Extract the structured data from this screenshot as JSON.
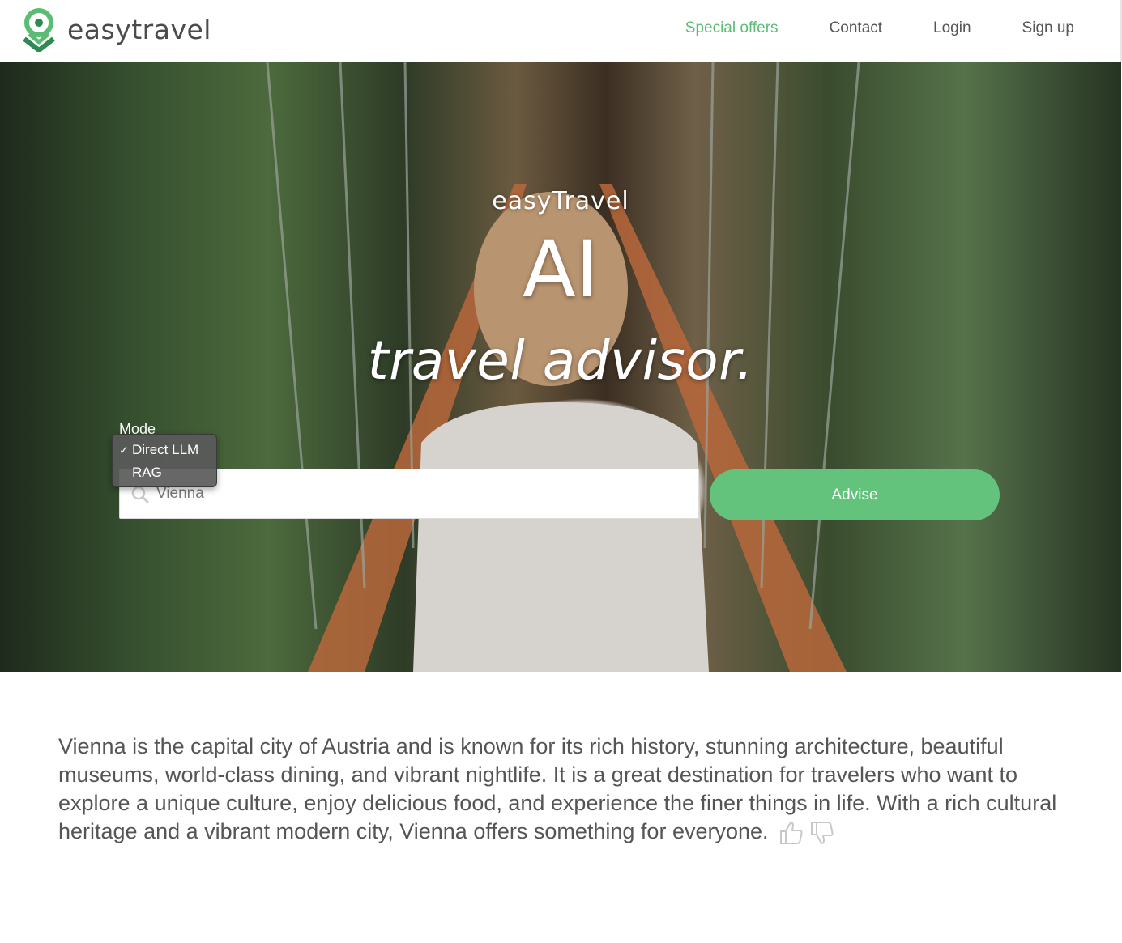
{
  "header": {
    "brand": "easytravel",
    "nav": [
      {
        "label": "Special offers",
        "active": true
      },
      {
        "label": "Contact",
        "active": false
      },
      {
        "label": "Login",
        "active": false
      },
      {
        "label": "Sign up",
        "active": false
      }
    ]
  },
  "hero": {
    "title_small": "easyTravel",
    "title_large": "AI",
    "title_sub": "travel advisor."
  },
  "form": {
    "mode_label": "Mode",
    "mode_options": [
      "Direct LLM",
      "RAG"
    ],
    "selected_mode": "Direct LLM",
    "search_value": "Vienna",
    "advise_label": "Advise"
  },
  "answer": {
    "text": "Vienna is the capital city of Austria and is known for its rich history, stunning architecture, beautiful museums, world-class dining, and vibrant nightlife. It is a great destination for travelers who want to explore a unique culture, enjoy delicious food, and experience the finer things in life. With a rich cultural heritage and a vibrant modern city, Vienna offers something for everyone."
  },
  "colors": {
    "accent": "#5bbd74",
    "button": "#63c27b",
    "text": "#555555"
  },
  "icons": [
    "logo-icon",
    "search-icon",
    "thumbs-up-icon",
    "thumbs-down-icon",
    "checkmark-icon"
  ]
}
